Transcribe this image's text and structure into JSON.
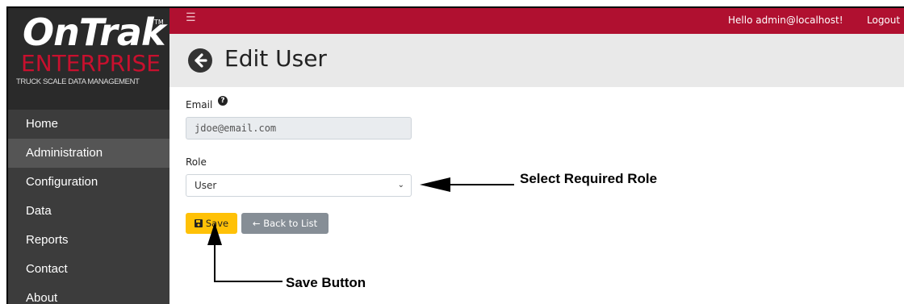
{
  "logo": {
    "brand": "OnTrak",
    "trademark": "TM",
    "product": "ENTERPRISE",
    "tagline": "TRUCK SCALE DATA MANAGEMENT"
  },
  "sidebar": {
    "items": [
      {
        "label": "Home",
        "active": false
      },
      {
        "label": "Administration",
        "active": true
      },
      {
        "label": "Configuration",
        "active": false
      },
      {
        "label": "Data",
        "active": false
      },
      {
        "label": "Reports",
        "active": false
      },
      {
        "label": "Contact",
        "active": false
      },
      {
        "label": "About",
        "active": false
      }
    ]
  },
  "topbar": {
    "menu_icon": "hamburger-icon",
    "greeting": "Hello admin@localhost!",
    "logout_label": "Logout"
  },
  "header": {
    "back_icon": "arrow-left-circle-icon",
    "title": "Edit User"
  },
  "form": {
    "email_label": "Email",
    "email_help_icon": "question-circle-icon",
    "email_value": "jdoe@email.com",
    "role_label": "Role",
    "role_value": "User",
    "save_label": "Save",
    "save_icon": "floppy-disk-icon",
    "back_label": "← Back to List"
  },
  "annotations": {
    "role_callout": "Select Required Role",
    "save_callout": "Save Button"
  },
  "colors": {
    "topbar": "#b01030",
    "sidebar": "#3c3c3c",
    "sidebar_active": "#555555",
    "brand_red": "#c8102e",
    "save_button": "#ffc107",
    "back_button": "#868e96",
    "header_bg": "#e9e9e9"
  }
}
